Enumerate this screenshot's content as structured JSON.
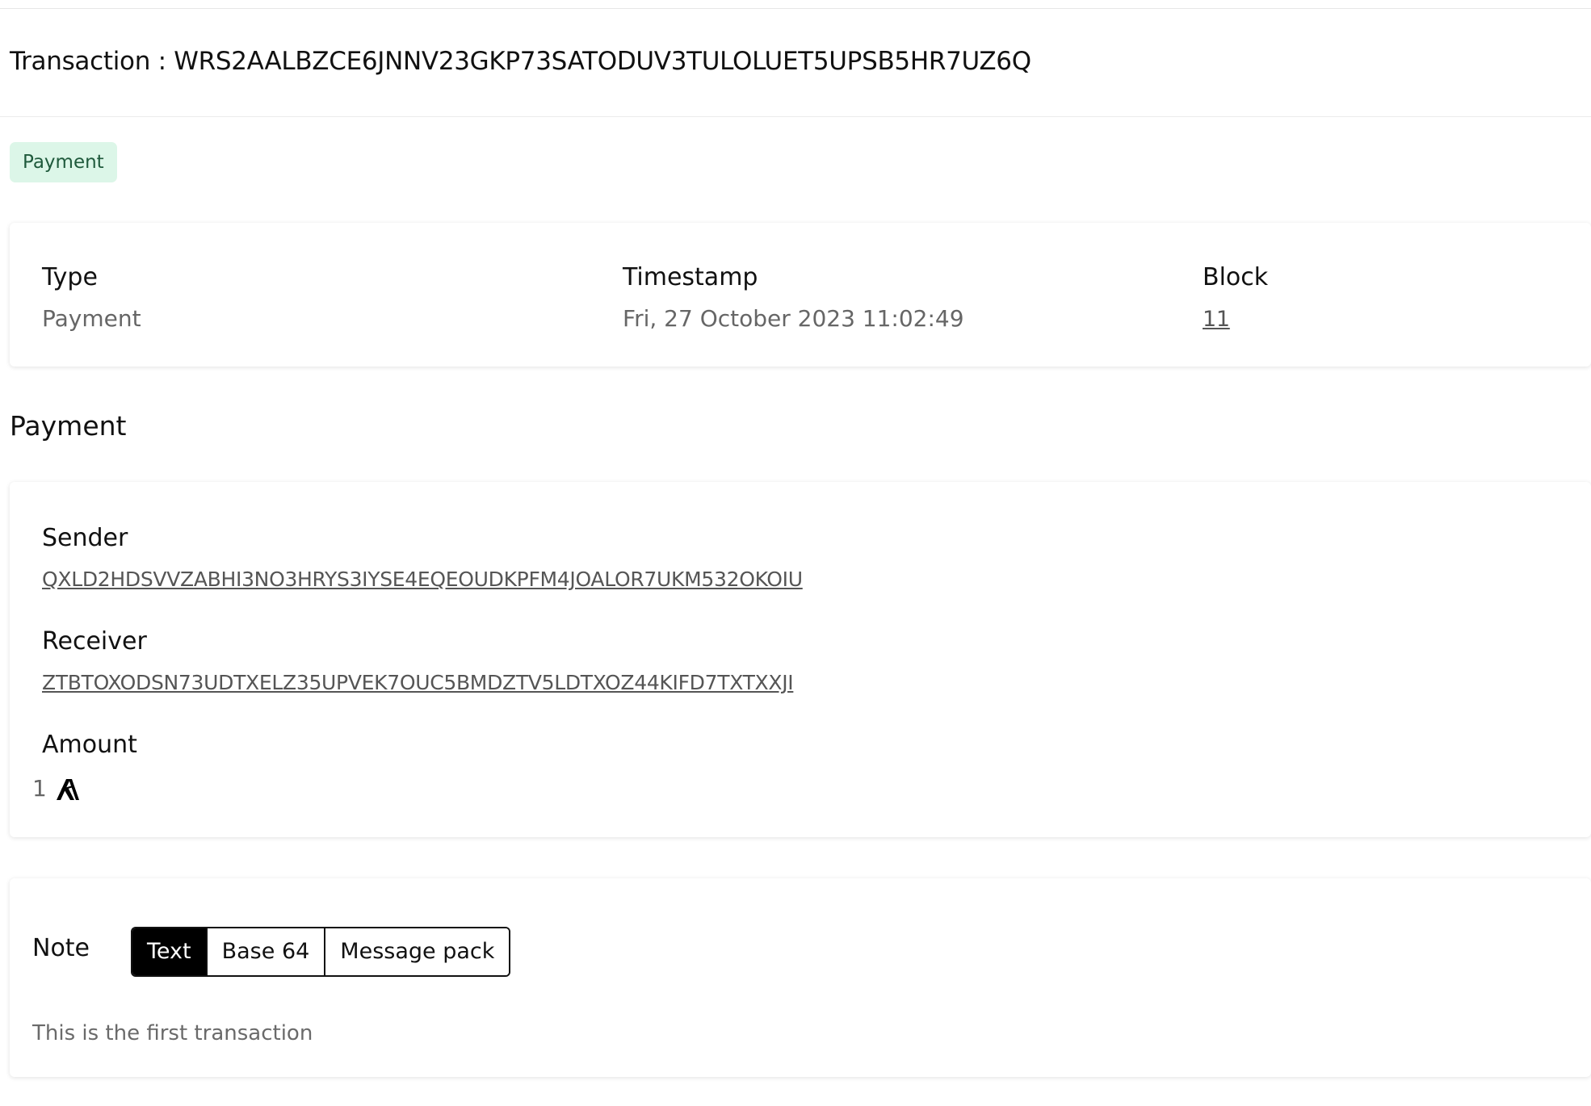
{
  "header": {
    "title": "Transaction : WRS2AALBZCE6JNNV23GKP73SATODUV3TULOLUET5UPSB5HR7UZ6Q",
    "badge": "Payment"
  },
  "summary": {
    "type_label": "Type",
    "type_value": "Payment",
    "timestamp_label": "Timestamp",
    "timestamp_value": "Fri, 27 October 2023 11:02:49",
    "block_label": "Block",
    "block_value": "11"
  },
  "payment": {
    "section_title": "Payment",
    "sender_label": "Sender",
    "sender_value": "QXLD2HDSVVZABHI3NO3HRYS3IYSE4EQEOUDKPFM4JOALOR7UKM532OKOIU",
    "receiver_label": "Receiver",
    "receiver_value": "ZTBTOXODSN73UDTXELZ35UPVEK7OUC5BMDZTV5LDTXOZ44KIFD7TXTXXJI",
    "amount_label": "Amount",
    "amount_value": "1",
    "amount_icon": "algorand-icon"
  },
  "note": {
    "label": "Note",
    "tabs": [
      "Text",
      "Base 64",
      "Message pack"
    ],
    "active_tab": "Text",
    "text": "This is the first transaction"
  },
  "colors": {
    "badge_bg": "#dcf6e8",
    "badge_text": "#1f5a3c",
    "active_tab_bg": "#000000"
  }
}
